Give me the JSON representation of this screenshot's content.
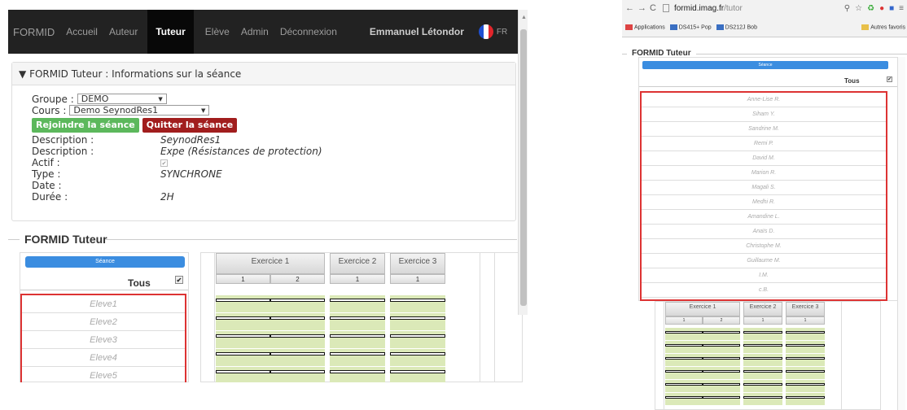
{
  "left": {
    "nav": {
      "brand": "FORMID",
      "items": [
        "Accueil",
        "Auteur",
        "Tuteur",
        "Elève",
        "Admin",
        "Déconnexion"
      ],
      "active_index": 2,
      "user": "Emmanuel Létondor",
      "lang": "FR"
    },
    "panel": {
      "title": "FORMID Tuteur : Informations sur la séance",
      "groupe_label": "Groupe :",
      "groupe_value": "DEMO",
      "cours_label": "Cours :",
      "cours_value": "Demo SeynodRes1",
      "join_button": "Rejoindre la séance",
      "quit_button": "Quitter la séance",
      "fields": [
        {
          "label": "Description :",
          "value": "SeynodRes1"
        },
        {
          "label": "Description :",
          "value": "Expe (Résistances de protection)"
        },
        {
          "label": "Actif :",
          "value": ""
        },
        {
          "label": "Type :",
          "value": "SYNCHRONE"
        },
        {
          "label": "Date :",
          "value": ""
        },
        {
          "label": "Durée :",
          "value": "2H"
        }
      ]
    },
    "tuteur": {
      "legend": "FORMID Tuteur",
      "seance_button": "Séance",
      "tous_label": "Tous",
      "students": [
        "Eleve1",
        "Eleve2",
        "Eleve3",
        "Eleve4",
        "Eleve5"
      ],
      "exercises": [
        {
          "title": "Exercice 1",
          "steps": [
            "1",
            "2"
          ]
        },
        {
          "title": "Exercice 2",
          "steps": [
            "1"
          ]
        },
        {
          "title": "Exercice 3",
          "steps": [
            "1"
          ]
        }
      ]
    }
  },
  "right": {
    "browser": {
      "url_host": "formid.imag.fr",
      "url_path": "/tutor",
      "bookmarks": [
        "Applications",
        "DS415+ Pop",
        "DS212J Bob"
      ],
      "bookmarks_right": "Autres favoris"
    },
    "tuteur": {
      "legend": "FORMID Tuteur",
      "seance_button": "Séance",
      "tous_label": "Tous",
      "students": [
        "Anne-Lise R.",
        "Siham Y.",
        "Sandrine M.",
        "Remi P.",
        "David M.",
        "Marion R.",
        "Magali S.",
        "Medhi R.",
        "Amandine L.",
        "Anaïs D.",
        "Christophe M.",
        "Guillaume M.",
        "I.M.",
        "c.B."
      ],
      "exercises": [
        {
          "title": "Exercice 1",
          "steps": [
            "1",
            "2"
          ]
        },
        {
          "title": "Exercice 2",
          "steps": [
            "1"
          ]
        },
        {
          "title": "Exercice 3",
          "steps": [
            "1"
          ]
        }
      ]
    }
  },
  "colors": {
    "nav_bg": "#222222",
    "join": "#5cb85c",
    "quit": "#a11d1d",
    "seance": "#3b8de0",
    "highlight": "#dd3333",
    "progress": "#dbe9b8"
  }
}
